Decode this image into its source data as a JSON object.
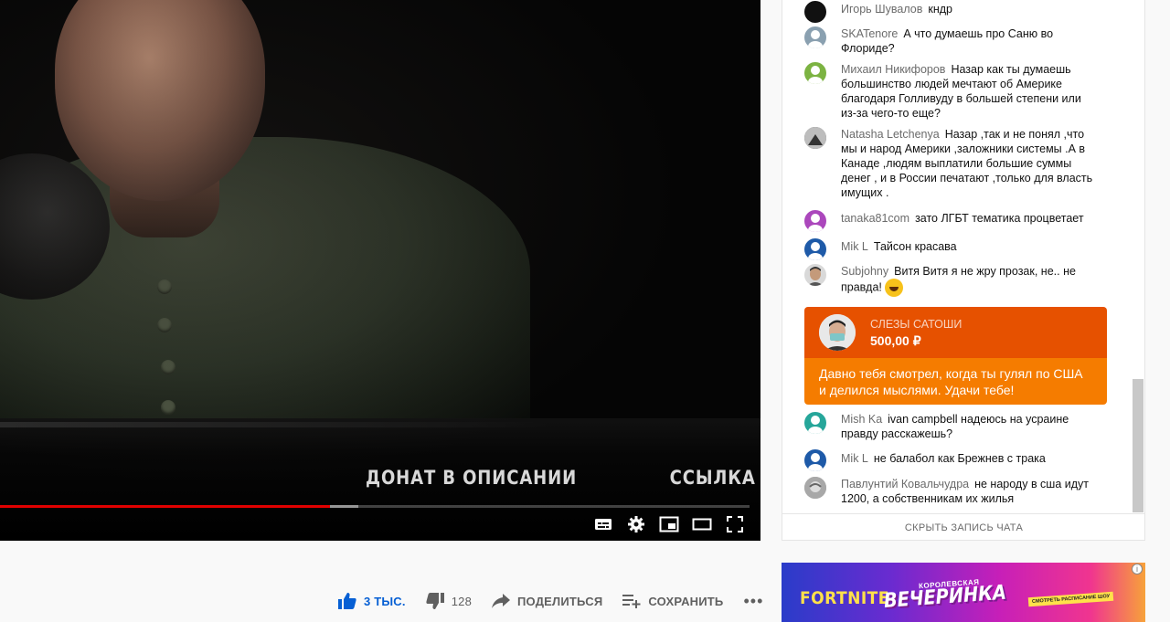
{
  "video": {
    "ticker": [
      "ДОНАТ В ОПИСАНИИ",
      "ССЫЛКА НА Д"
    ],
    "played_fraction": 0.44,
    "buffered_fraction": 0.478,
    "controls": [
      "subtitles-icon",
      "settings-icon",
      "miniplayer-icon",
      "theater-mode-icon",
      "fullscreen-icon"
    ]
  },
  "chat": {
    "messages": [
      {
        "author": "Игорь Шувалов",
        "text": "кндр",
        "avatar_color": "#111111"
      },
      {
        "author": "SKATenore",
        "text": "А что думаешь про Саню во Флориде?",
        "avatar_color": "#8aa0b0"
      },
      {
        "author": "Михаил Никифоров",
        "text": "Назар как ты думаешь большинство людей мечтают об Америке благодаря Голливуду в большей степени или из-за чего-то еще?",
        "avatar_color": "#7cb342"
      },
      {
        "author": "Natasha Letchenya",
        "text": "Назар ,так и не понял ,что мы и народ Америки ,заложники системы .А в Канаде ,людям выплатили большие суммы денег , и в России печатают ,только для власть имущих .",
        "avatar_color": "#555555"
      },
      {
        "author": "tanaka81com",
        "text": "зато ЛГБТ тематика процветает",
        "avatar_color": "#ab47bc"
      },
      {
        "author": "Mik L",
        "text": "Тайсон красава",
        "avatar_color": "#1e5aa8"
      },
      {
        "author": "Subjohny",
        "text": "Витя Витя я не жру прозак, не.. не правда!",
        "avatar_color": "#d9d9d9"
      },
      {
        "author": "Mish Ka",
        "text": "ivan campbell надеюсь на усраине правду расскажешь?",
        "avatar_color": "#26a69a"
      },
      {
        "author": "Mik L",
        "text": "не балабол как Брежнев с трака",
        "avatar_color": "#1e5aa8"
      },
      {
        "author": "Павлунтий Ковальчудра",
        "text": "не народу в сша идут 1200, а собственникам их жилья",
        "avatar_color": "#9e9e9e"
      }
    ],
    "superchat": {
      "author": "СЛЕЗЫ САТОШИ",
      "amount": "500,00 ₽",
      "text": "Давно тебя смотрел, когда ты гулял по США и делился мыслями. Удачи тебе!",
      "header_color": "#e65100",
      "body_color": "#f57c00"
    },
    "hide_label": "СКРЫТЬ ЗАПИСЬ ЧАТА"
  },
  "actions": {
    "like_count": "3 ТЫС.",
    "dislike_count": "128",
    "share_label": "ПОДЕЛИТЬСЯ",
    "save_label": "СОХРАНИТЬ",
    "more_label": "•••"
  },
  "ad": {
    "brand": "FORTNITE",
    "small_caption": "КОРОЛЕВСКАЯ",
    "title": "ВЕЧЕРИНКА",
    "cta": "СМОТРЕТЬ РАСПИСАНИЕ ШОУ",
    "info": "i"
  }
}
